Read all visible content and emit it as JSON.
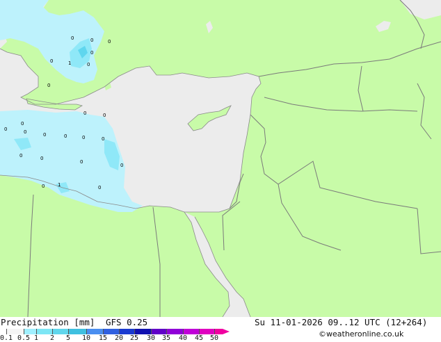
{
  "title": "Precipitation [mm]",
  "model": "GFS 0.25",
  "valid_time": "Su 11-01-2026 09..12 UTC (12+264)",
  "credit": "©weatheronline.co.uk",
  "legend": {
    "ticks": [
      "0.1",
      "0.5",
      "1",
      "2",
      "5",
      "10",
      "15",
      "20",
      "25",
      "30",
      "35",
      "40",
      "45",
      "50"
    ],
    "colors": [
      "#f5f5f5",
      "#a0f0ff",
      "#7de6f5",
      "#60d6ec",
      "#3fc0e0",
      "#4a8ef0",
      "#3060e0",
      "#1a3ad0",
      "#1010b0",
      "#6000c8",
      "#9000d8",
      "#c000d8",
      "#e000c0",
      "#f000a0"
    ]
  },
  "colors": {
    "land": "#c8fba8",
    "sea": "#ececec",
    "border": "#7a7a7a",
    "coast": "#8a8a8a",
    "precip_light": "#bdf2fc",
    "precip_mid": "#8fe8f8",
    "precip_strong": "#5fd6ee"
  },
  "point_values": [
    {
      "label": "0"
    },
    {
      "label": "0"
    },
    {
      "label": "0"
    },
    {
      "label": "1"
    },
    {
      "label": "0"
    },
    {
      "label": "0"
    },
    {
      "label": "0"
    },
    {
      "label": "0"
    },
    {
      "label": "0"
    },
    {
      "label": "0"
    },
    {
      "label": "0"
    },
    {
      "label": "0"
    },
    {
      "label": "0"
    },
    {
      "label": "0"
    },
    {
      "label": "0"
    },
    {
      "label": "0"
    },
    {
      "label": "0"
    },
    {
      "label": "0"
    },
    {
      "label": "0"
    },
    {
      "label": "1"
    },
    {
      "label": "0"
    },
    {
      "label": "0"
    },
    {
      "label": "0"
    },
    {
      "label": "0"
    }
  ]
}
